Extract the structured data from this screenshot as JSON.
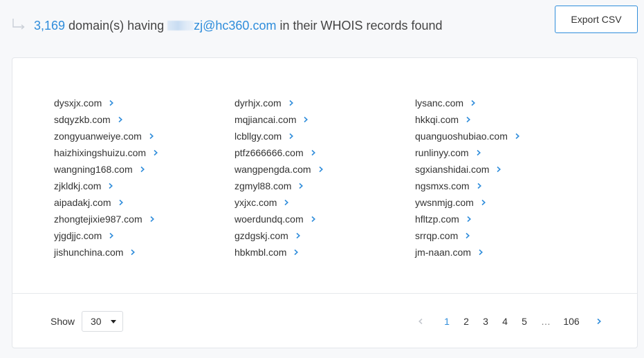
{
  "header": {
    "count": "3,169",
    "text_before": " domain(s) having ",
    "email_visible": "zj@hc360.com",
    "text_after": " in their WHOIS records found",
    "export_label": "Export CSV"
  },
  "columns": [
    [
      "dysxjx.com",
      "sdqyzkb.com",
      "zongyuanweiye.com",
      "haizhixingshuizu.com",
      "wangning168.com",
      "zjkldkj.com",
      "aipadakj.com",
      "zhongtejixie987.com",
      "yjgdjjc.com",
      "jishunchina.com"
    ],
    [
      "dyrhjx.com",
      "mqjiancai.com",
      "lcbllgy.com",
      "ptfz666666.com",
      "wangpengda.com",
      "zgmyl88.com",
      "yxjxc.com",
      "woerdundq.com",
      "gzdgskj.com",
      "hbkmbl.com"
    ],
    [
      "lysanc.com",
      "hkkqi.com",
      "quanguoshubiao.com",
      "runlinyy.com",
      "sgxianshidai.com",
      "ngsmxs.com",
      "ywsnmjg.com",
      "hfltzp.com",
      "srrqp.com",
      "jm-naan.com"
    ]
  ],
  "pagination": {
    "show_label": "Show",
    "page_size": "30",
    "pages": [
      "1",
      "2",
      "3",
      "4",
      "5"
    ],
    "ellipsis": "…",
    "last_page": "106",
    "current": "1"
  },
  "colors": {
    "accent": "#2f8ddb",
    "text": "#333333",
    "border": "#e3e6ea"
  },
  "icons": {
    "corner": "return-arrow-icon",
    "row": "chevron-right-icon",
    "prev": "chevron-left-icon",
    "next": "chevron-right-icon",
    "select": "caret-down-icon"
  }
}
